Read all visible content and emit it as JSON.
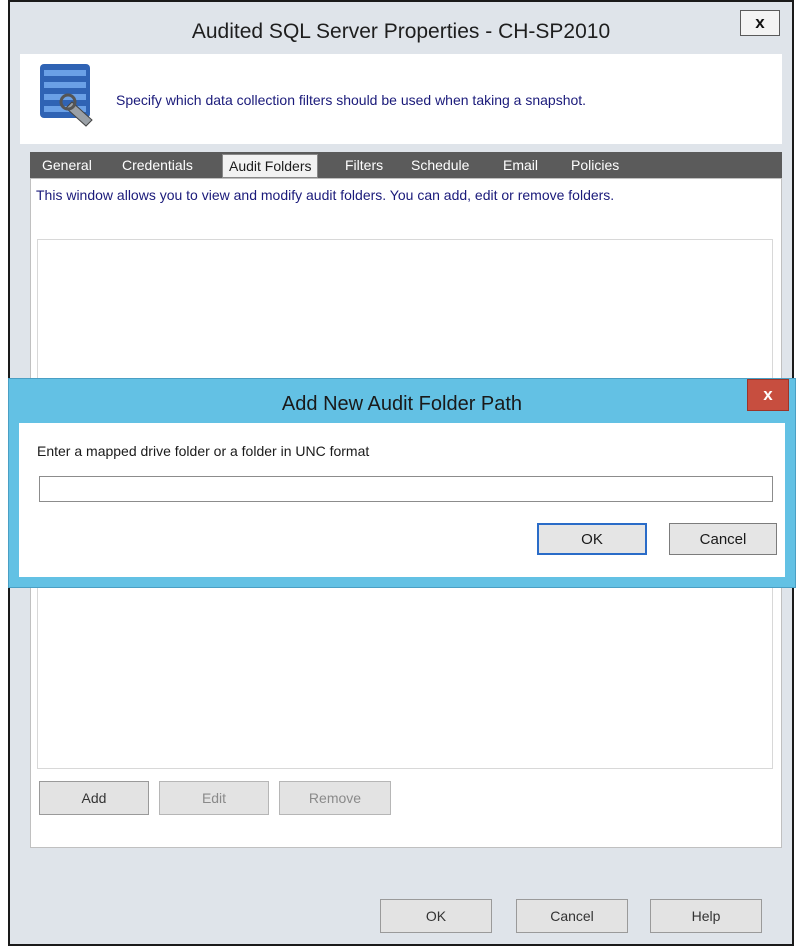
{
  "window": {
    "title": "Audited SQL Server Properties - CH-SP2010",
    "close_glyph": "x",
    "header_text": "Specify which data collection filters should be used when taking a snapshot.",
    "header_icon": "sql-server-config-icon"
  },
  "tabs": [
    {
      "label": "General",
      "active": false
    },
    {
      "label": "Credentials",
      "active": false
    },
    {
      "label": "Audit Folders",
      "active": true
    },
    {
      "label": "Filters",
      "active": false
    },
    {
      "label": "Schedule",
      "active": false
    },
    {
      "label": "Email",
      "active": false
    },
    {
      "label": "Policies",
      "active": false
    }
  ],
  "audit_folders": {
    "description": "This window allows you to view and modify audit folders.  You can add, edit or remove folders.",
    "add_label": "Add",
    "edit_label": "Edit",
    "remove_label": "Remove"
  },
  "footer": {
    "ok_label": "OK",
    "cancel_label": "Cancel",
    "help_label": "Help"
  },
  "dialog": {
    "title": "Add New Audit Folder Path",
    "close_glyph": "x",
    "prompt": "Enter a mapped drive folder or a folder in UNC format",
    "input_value": "",
    "ok_label": "OK",
    "cancel_label": "Cancel"
  },
  "colors": {
    "dialog_title_bar": "#63c1e4",
    "dialog_close": "#c74e3f",
    "tab_bar": "#5b5b5b",
    "info_text": "#1a1a7a"
  }
}
